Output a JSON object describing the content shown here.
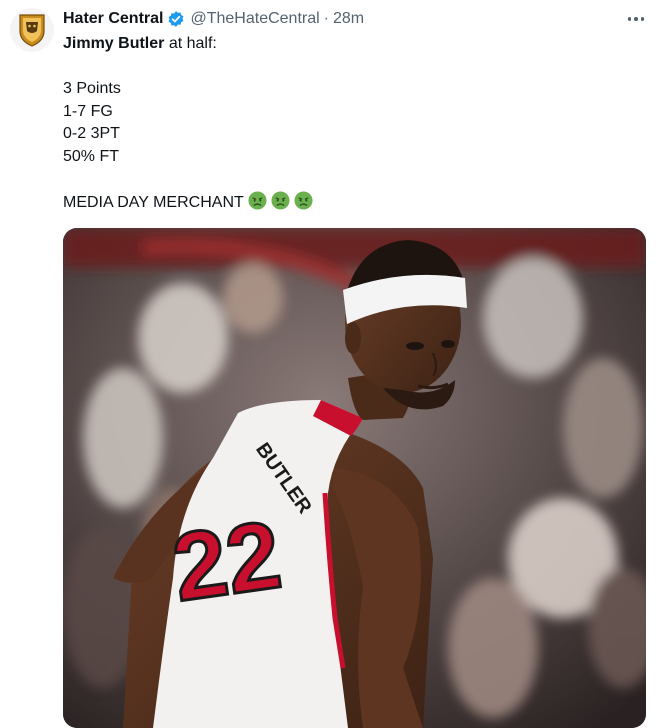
{
  "tweet": {
    "display_name": "Hater Central",
    "handle": "@TheHateCentral",
    "separator": "·",
    "time": "28m",
    "body": {
      "player_name": "Jimmy Butler",
      "intro_rest": " at half:",
      "stats": [
        "3 Points",
        "1-7 FG",
        "0-2 3PT",
        "50% FT"
      ],
      "closing": "MEDIA DAY MERCHANT"
    },
    "emoji_count": 3,
    "media": {
      "jersey_name": "BUTLER",
      "jersey_number": "22"
    }
  },
  "icons": {
    "avatar": "hater-central-logo",
    "verified": "verified-badge-icon",
    "more": "more-options-icon",
    "emoji": "nauseated-face-emoji"
  },
  "colors": {
    "verified_blue": "#1d9bf0",
    "secondary_text": "#536471",
    "primary_text": "#0f1419",
    "emoji_green": "#6ab04c",
    "jersey_red": "#c8102e"
  }
}
